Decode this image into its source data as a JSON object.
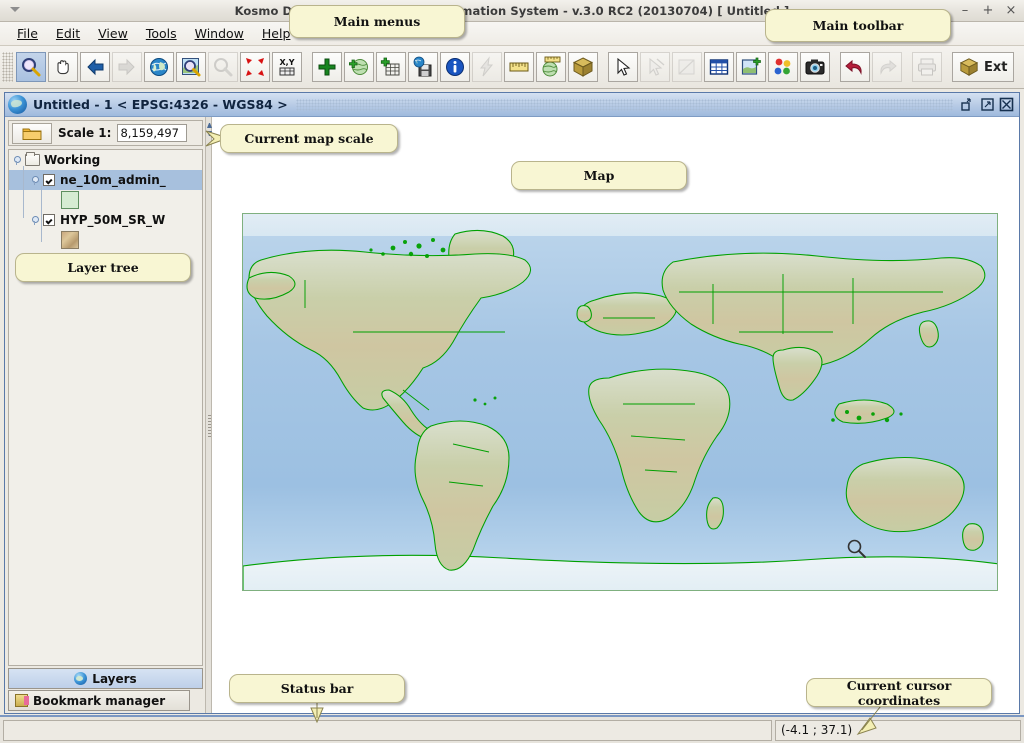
{
  "window": {
    "os_title": "Kosmo Desktop - Geographic Information System - v.3.0 RC2 (20130704)  [ Untitled ]",
    "minimize": "–",
    "maximize": "+",
    "close": "×"
  },
  "menubar": {
    "items": [
      {
        "label": "File",
        "mnemonic": "F"
      },
      {
        "label": "Edit",
        "mnemonic": "E"
      },
      {
        "label": "View",
        "mnemonic": "V"
      },
      {
        "label": "Tools",
        "mnemonic": "T"
      },
      {
        "label": "Window",
        "mnemonic": "W"
      },
      {
        "label": "Help",
        "mnemonic": "H"
      }
    ]
  },
  "toolbar": {
    "buttons": [
      {
        "icon": "zoom-in-icon",
        "name": "zoom-in-tool",
        "state": "selected"
      },
      {
        "icon": "pan-hand-icon",
        "name": "pan-tool",
        "state": "normal"
      },
      {
        "icon": "back-arrow-icon",
        "name": "previous-extent-button",
        "state": "normal"
      },
      {
        "icon": "forward-arrow-icon",
        "name": "next-extent-button",
        "state": "disabled"
      },
      {
        "icon": "globe-icon",
        "name": "zoom-full-extent-button",
        "state": "normal"
      },
      {
        "icon": "zoom-layer-icon",
        "name": "zoom-to-layer-button",
        "state": "normal"
      },
      {
        "icon": "zoom-selected-icon",
        "name": "zoom-to-selection-button",
        "state": "disabled"
      },
      {
        "icon": "zoom-collapse-icon",
        "name": "zoom-to-feature-button",
        "state": "normal"
      },
      {
        "icon": "xy-coordinate-icon",
        "name": "goto-xy-button",
        "state": "normal"
      },
      {
        "icon": "add-layer-icon",
        "name": "add-layer-button",
        "state": "normal"
      },
      {
        "icon": "add-wms-layer-icon",
        "name": "add-remote-layer-button",
        "state": "normal"
      },
      {
        "icon": "add-table-icon",
        "name": "add-table-button",
        "state": "normal"
      },
      {
        "icon": "save-map-icon",
        "name": "save-map-button",
        "state": "normal"
      },
      {
        "icon": "info-icon",
        "name": "feature-info-button",
        "state": "normal"
      },
      {
        "icon": "lightning-icon",
        "name": "quick-action-button",
        "state": "disabled"
      },
      {
        "icon": "ruler-icon",
        "name": "measure-distance-button",
        "state": "normal"
      },
      {
        "icon": "globe-ruler-icon",
        "name": "measure-geodesic-button",
        "state": "normal"
      },
      {
        "icon": "box-icon",
        "name": "extension-box-button",
        "state": "normal"
      },
      {
        "icon": "select-arrow-icon",
        "name": "select-tool",
        "state": "normal"
      },
      {
        "icon": "deselect-arrow-icon",
        "name": "deselect-tool",
        "state": "disabled"
      },
      {
        "icon": "edit-geometry-icon",
        "name": "edit-geometry-button",
        "state": "disabled"
      },
      {
        "icon": "table-grid-icon",
        "name": "attribute-table-button",
        "state": "normal"
      },
      {
        "icon": "new-view-icon",
        "name": "new-view-button",
        "state": "normal"
      },
      {
        "icon": "symbology-icon",
        "name": "symbology-button",
        "state": "normal"
      },
      {
        "icon": "camera-icon",
        "name": "export-image-button",
        "state": "normal"
      },
      {
        "icon": "undo-icon",
        "name": "undo-button",
        "state": "normal"
      },
      {
        "icon": "redo-icon",
        "name": "redo-button",
        "state": "disabled"
      },
      {
        "icon": "print-icon",
        "name": "print-button",
        "state": "disabled"
      },
      {
        "icon": "extensions-box-icon",
        "name": "extensions-button",
        "state": "normal",
        "label": "Ext"
      }
    ],
    "ext_label": "Ext"
  },
  "mdi": {
    "title": "Untitled - 1 < EPSG:4326 - WGS84 >",
    "restore_small_title": "restore",
    "maximize_title": "maximize",
    "close_title": "close"
  },
  "scale": {
    "label": "Scale 1:",
    "value": "8,159,497",
    "placeholder": "",
    "folder_icon": "folder-icon"
  },
  "layer_tree": {
    "root": {
      "label": "Working",
      "icon": "folder-icon"
    },
    "layers": [
      {
        "label": "ne_10m_admin_",
        "checked": true,
        "selected": true,
        "swatch": "vector-polygon-swatch"
      },
      {
        "label": "HYP_50M_SR_W",
        "checked": true,
        "selected": false,
        "swatch": "raster-swatch"
      }
    ]
  },
  "panel_tabs": {
    "active": {
      "label": "Layers",
      "icon": "globe-icon"
    },
    "inactive": {
      "label": "Bookmark manager",
      "icon": "bookmark-icon"
    }
  },
  "statusbar": {
    "message": "",
    "coordinates": "(-4.1 ; 37.1)"
  },
  "callouts": [
    {
      "id": "main-menus",
      "text": "Main menus"
    },
    {
      "id": "main-toolbar",
      "text": "Main toolbar"
    },
    {
      "id": "current-map-scale",
      "text": "Current map scale"
    },
    {
      "id": "map",
      "text": "Map"
    },
    {
      "id": "layer-tree",
      "text": "Layer tree"
    },
    {
      "id": "status-bar",
      "text": "Status bar"
    },
    {
      "id": "current-cursor-coordinates",
      "text": "Current cursor coordinates"
    }
  ],
  "colors": {
    "callout_bg": "#f8f6d3",
    "callout_border": "#b9b48c",
    "mdi_title": "#9fbadd",
    "selection": "#a7c0dd",
    "country_border": "#00a000",
    "ocean": "#a9c9e6",
    "statusbar_top_border": "#7b97c2"
  },
  "map": {
    "cursor_icon": "magnifier-cursor",
    "projection": "EPSG:4326 - WGS84"
  }
}
